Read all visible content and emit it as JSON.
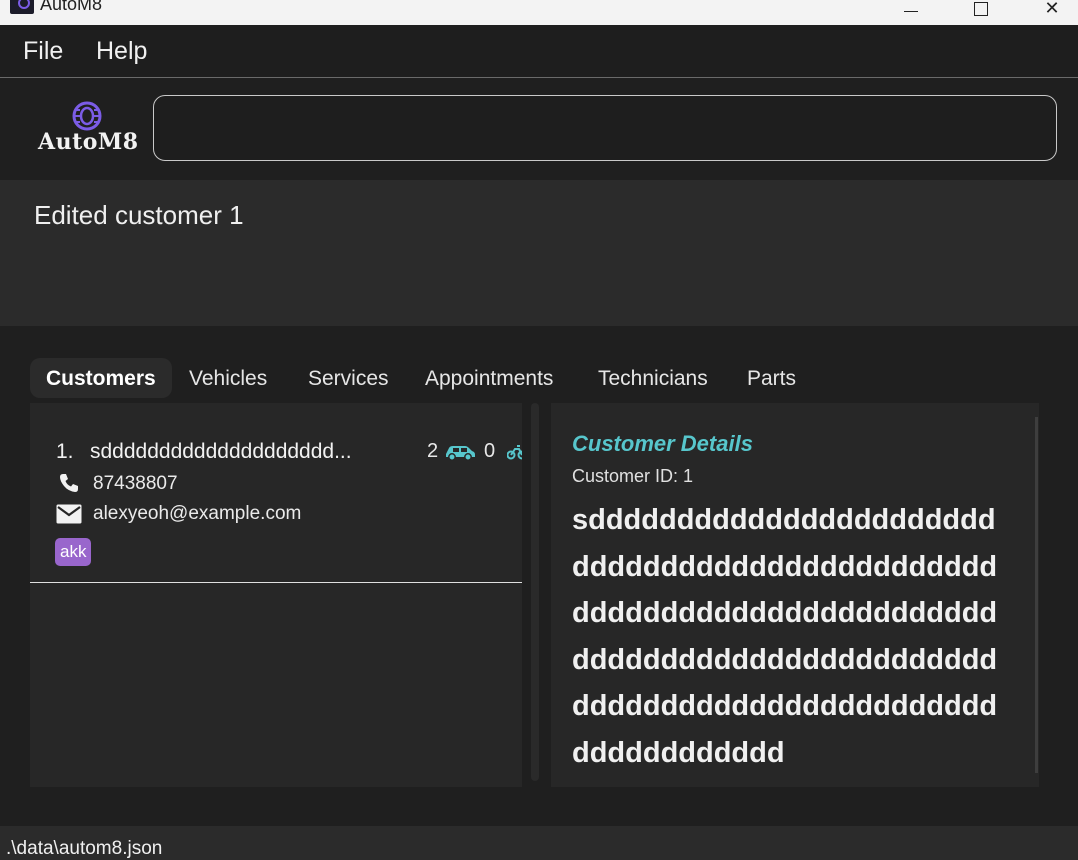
{
  "window": {
    "title": "AutoM8",
    "app_icon": "automb-app-icon",
    "controls": [
      "minimize-icon",
      "maximize-icon",
      "close-icon"
    ],
    "close_glyph": "✕"
  },
  "menu": {
    "file": "File",
    "help": "Help"
  },
  "header": {
    "logo_text": "AutoM8",
    "logo_icon": "tire-icon",
    "command_value": ""
  },
  "result": {
    "message": "Edited customer 1"
  },
  "tabs": [
    {
      "label": "Customers",
      "active": true
    },
    {
      "label": "Vehicles",
      "active": false
    },
    {
      "label": "Services",
      "active": false
    },
    {
      "label": "Appointments",
      "active": false
    },
    {
      "label": "Technicians",
      "active": false
    },
    {
      "label": "Parts",
      "active": false
    }
  ],
  "customers": [
    {
      "index": "1.",
      "name": "sdddddddddddddddddddd...",
      "vehicle_count": "2",
      "appointment_count": "0",
      "phone": "87438807",
      "email": "alexyeoh@example.com",
      "tags": [
        "akk"
      ]
    }
  ],
  "details": {
    "title": "Customer Details",
    "customer_id": "Customer ID: 1",
    "name": "sddddddddddddddddddddddddddddddddddddddddddddddddddddddddddddddddddddddddddddddddddddddddddddddddddddddddddddddddddddddddddddddddddd"
  },
  "status": {
    "path": ".\\data\\autom8.json"
  },
  "colors": {
    "accent_teal": "#57c6cc",
    "tag_purple": "#9966cc",
    "logo_purple": "#7b5ce6"
  }
}
